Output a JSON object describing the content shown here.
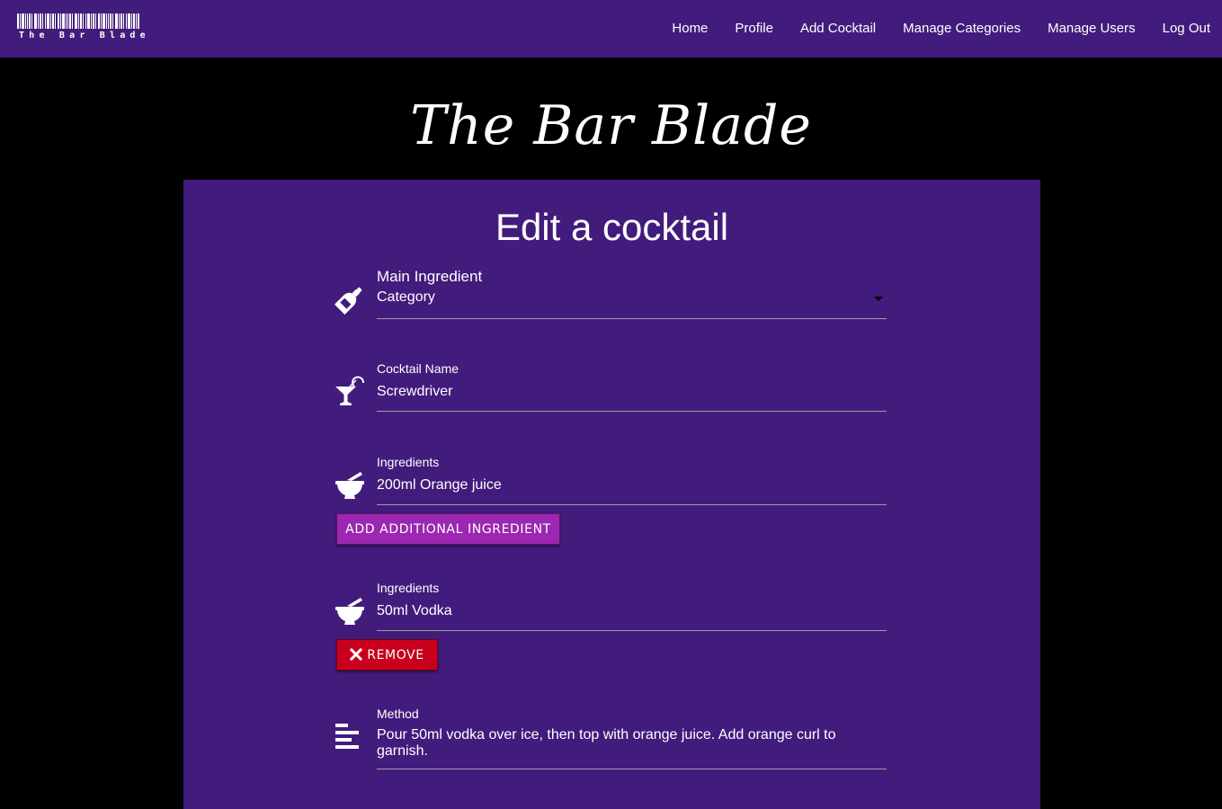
{
  "brand": {
    "logo_text": "The Bar Blade"
  },
  "nav": {
    "items": [
      {
        "label": "Home"
      },
      {
        "label": "Profile"
      },
      {
        "label": "Add Cocktail"
      },
      {
        "label": "Manage Categories"
      },
      {
        "label": "Manage Users"
      },
      {
        "label": "Log Out"
      }
    ]
  },
  "hero": {
    "title": "The Bar Blade"
  },
  "form": {
    "title": "Edit a cocktail",
    "main_ingredient": {
      "label": "Main Ingredient",
      "selected": "Category",
      "icon": "wine-bottle-icon"
    },
    "cocktail_name": {
      "label": "Cocktail Name",
      "value": "Screwdriver",
      "icon": "cocktail-glass-icon"
    },
    "ingredients": [
      {
        "label": "Ingredients",
        "value": "200ml Orange juice",
        "icon": "mortar-pestle-icon"
      },
      {
        "label": "Ingredients",
        "value": "50ml Vodka",
        "icon": "mortar-pestle-icon"
      }
    ],
    "add_ingredient_button": "ADD ADDITIONAL INGREDIENT",
    "remove_button": "REMOVE",
    "method": {
      "label": "Method",
      "value": "Pour 50ml vodka over ice, then top with orange juice. Add orange curl to garnish.",
      "icon": "align-left-icon"
    }
  },
  "colors": {
    "nav_bg": "#421c7c",
    "page_bg": "#000000",
    "panel_bg": "#421c7c",
    "add_button": "#9c27b0",
    "remove_button": "#c8001e",
    "underline": "#9e9e9e"
  }
}
